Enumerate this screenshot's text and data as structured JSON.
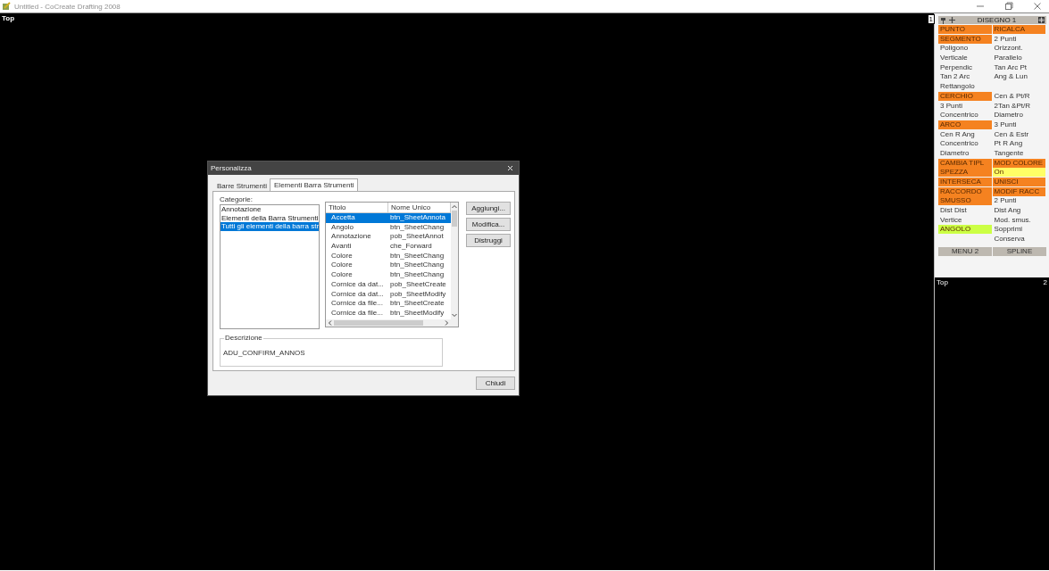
{
  "window": {
    "title": "Untitled - CoCreate Drafting 2008"
  },
  "viewports": [
    {
      "label": "Top",
      "number": "1"
    },
    {
      "label": "Top",
      "number": "2"
    }
  ],
  "menu_panel": {
    "title": "DISEGNO 1",
    "rows": [
      {
        "left": {
          "text": "PUNTO",
          "color": "#f58220"
        },
        "right": {
          "text": "RICALCA",
          "color": "#f58220"
        }
      },
      {
        "left": {
          "text": "SEGMENTO",
          "color": "#f58220"
        },
        "right": {
          "text": "2 Punti"
        }
      },
      {
        "left": {
          "text": "Poligono"
        },
        "right": {
          "text": "Orizzont."
        }
      },
      {
        "left": {
          "text": "Verticale"
        },
        "right": {
          "text": "Parallelo"
        }
      },
      {
        "left": {
          "text": "Perpendic"
        },
        "right": {
          "text": "Tan Arc Pt"
        }
      },
      {
        "left": {
          "text": "Tan 2 Arc"
        },
        "right": {
          "text": "Ang & Lun"
        }
      },
      {
        "left": {
          "text": "Rettangolo"
        }
      },
      {
        "left": {
          "text": "CERCHIO",
          "color": "#f58220"
        },
        "right": {
          "text": "Cen & Pt/R"
        }
      },
      {
        "left": {
          "text": "3 Punti"
        },
        "right": {
          "text": "2Tan &Pt/R"
        }
      },
      {
        "left": {
          "text": "Concentrico"
        },
        "right": {
          "text": "Diametro"
        }
      },
      {
        "left": {
          "text": "ARCO",
          "color": "#f58220"
        },
        "right": {
          "text": "3 Punti"
        }
      },
      {
        "left": {
          "text": "Cen R Ang"
        },
        "right": {
          "text": "Cen & Estr"
        }
      },
      {
        "left": {
          "text": "Concentrico"
        },
        "right": {
          "text": "Pt R Ang"
        }
      },
      {
        "left": {
          "text": "Diametro"
        },
        "right": {
          "text": "Tangente"
        }
      },
      {
        "left": {
          "text": "CAMBIA TIPL",
          "color": "#f58220"
        },
        "right": {
          "text": "MOD COLORE",
          "color": "#f58220"
        }
      },
      {
        "left": {
          "text": "SPEZZA",
          "color": "#f58220"
        },
        "right": {
          "text": "On",
          "color": "#ffff66"
        }
      },
      {
        "left": {
          "text": "INTERSECA",
          "color": "#f58220"
        },
        "right": {
          "text": "UNISCI",
          "color": "#f58220"
        }
      },
      {
        "left": {
          "text": "RACCORDO",
          "color": "#f58220"
        },
        "right": {
          "text": "MODIF RACC",
          "color": "#f58220"
        }
      },
      {
        "left": {
          "text": "SMUSSO",
          "color": "#f58220"
        },
        "right": {
          "text": "2 Punti"
        }
      },
      {
        "left": {
          "text": "Dist Dist"
        },
        "right": {
          "text": "Dist Ang"
        }
      },
      {
        "left": {
          "text": "Vertice"
        },
        "right": {
          "text": "Mod. smus."
        }
      },
      {
        "left": {
          "text": "ANGOLO",
          "color": "#ccff44"
        },
        "right": {
          "text": "Sopprimi"
        }
      },
      {
        "right": {
          "text": "Conserva"
        }
      }
    ],
    "footer_buttons": [
      "MENU 2",
      "SPLINE"
    ]
  },
  "dialog": {
    "title": "Personalizza",
    "tabs": [
      {
        "label": "Barre Strumenti",
        "selected": false
      },
      {
        "label": "Elementi Barra Strumenti",
        "selected": true
      }
    ],
    "categories_label": "Categorie:",
    "categories": [
      {
        "label": "Annotazione",
        "selected": false
      },
      {
        "label": "Elementi della Barra Strumenti",
        "selected": false
      },
      {
        "label": "Tutti gli elementi della barra str",
        "selected": true
      }
    ],
    "table": {
      "columns": [
        "Titolo",
        "Nome Unico"
      ],
      "rows": [
        {
          "cells": [
            "Accetta",
            "btn_SheetAnnota"
          ],
          "selected": true
        },
        {
          "cells": [
            "Angolo",
            "btn_SheetChang"
          ],
          "selected": false
        },
        {
          "cells": [
            "Annotazione",
            "pob_SheetAnnot"
          ],
          "selected": false
        },
        {
          "cells": [
            "Avanti",
            "che_Forward"
          ],
          "selected": false
        },
        {
          "cells": [
            "Colore",
            "btn_SheetChang"
          ],
          "selected": false
        },
        {
          "cells": [
            "Colore",
            "btn_SheetChang"
          ],
          "selected": false
        },
        {
          "cells": [
            "Colore",
            "btn_SheetChang"
          ],
          "selected": false
        },
        {
          "cells": [
            "Cornice da dat...",
            "pob_SheetCreate"
          ],
          "selected": false
        },
        {
          "cells": [
            "Cornice da dat...",
            "pob_SheetModify"
          ],
          "selected": false
        },
        {
          "cells": [
            "Cornice da file...",
            "btn_SheetCreate"
          ],
          "selected": false
        },
        {
          "cells": [
            "Cornice da file...",
            "btn_SheetModify"
          ],
          "selected": false
        }
      ]
    },
    "buttons": [
      "Aggiungi...",
      "Modifica...",
      "Distruggi"
    ],
    "description": {
      "label": "Descrizione",
      "value": "ADU_CONFIRM_ANNOS"
    },
    "close_button": "Chiudi"
  }
}
